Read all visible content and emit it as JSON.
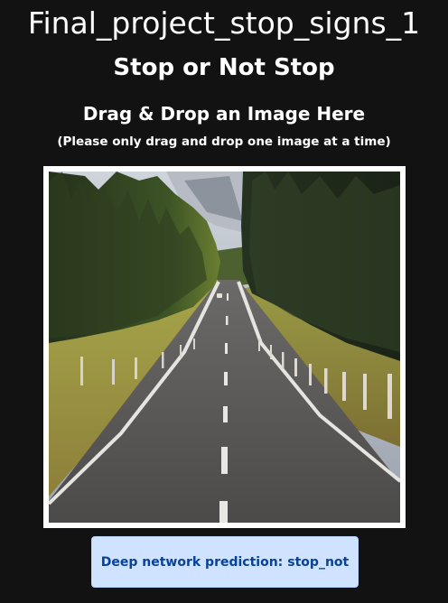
{
  "app": {
    "title": "Final_project_stop_signs_1",
    "subtitle": "Stop or Not Stop"
  },
  "upload": {
    "heading": "Drag & Drop an Image Here",
    "note": "(Please only drag and drop one image at a time)",
    "image_description": "road-through-forest-photo"
  },
  "result": {
    "label": "Deep network prediction:",
    "value": "stop_not"
  },
  "colors": {
    "background": "#121212",
    "text": "#ffffff",
    "alert_bg": "#cfe2ff",
    "alert_text": "#084298"
  }
}
